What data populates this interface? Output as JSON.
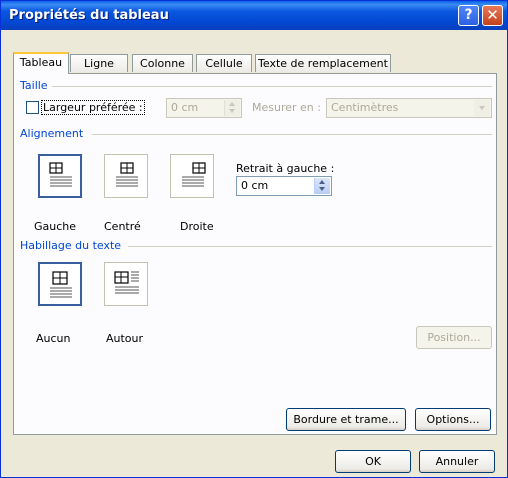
{
  "window": {
    "title": "Propriétés du tableau",
    "help_glyph": "?",
    "close_glyph": "✕"
  },
  "tabs": [
    {
      "label": "Tableau",
      "active": true
    },
    {
      "label": "Ligne",
      "active": false
    },
    {
      "label": "Colonne",
      "active": false
    },
    {
      "label": "Cellule",
      "active": false
    },
    {
      "label": "Texte de remplacement",
      "active": false
    }
  ],
  "taille": {
    "group_label": "Taille",
    "checkbox_label": "Largeur préférée :",
    "checked": false,
    "width_value": "0 cm",
    "measure_label": "Mesurer en :",
    "measure_value": "Centimètres"
  },
  "alignement": {
    "group_label": "Alignement",
    "options": [
      "Gauche",
      "Centré",
      "Droite"
    ],
    "selected": "Gauche",
    "indent_label": "Retrait à gauche :",
    "indent_value": "0 cm"
  },
  "habillage": {
    "group_label": "Habillage du texte",
    "options": [
      "Aucun",
      "Autour"
    ],
    "selected": "Aucun",
    "position_button": "Position..."
  },
  "buttons": {
    "borders": "Bordure et trame...",
    "options": "Options...",
    "ok": "OK",
    "cancel": "Annuler"
  },
  "colors": {
    "title_bar": "#0348d4",
    "group_label": "#0046d5",
    "dialog_bg": "#ece9d8",
    "tab_highlight": "#ffc83c"
  }
}
